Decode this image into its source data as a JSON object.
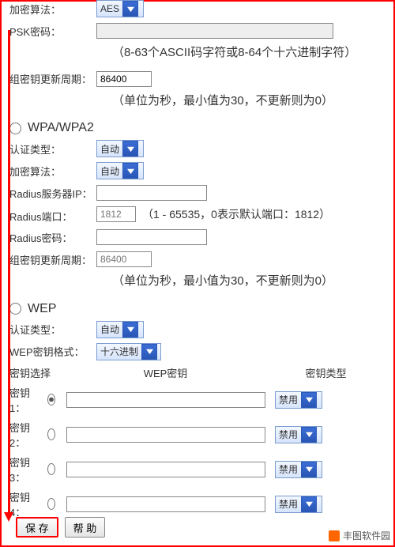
{
  "top": {
    "encrypt_label": "加密算法：",
    "encrypt_val": "AES",
    "psk_label": "PSK密码：",
    "psk_hint": "（8-63个ASCII码字符或8-64个十六进制字符）",
    "group_label": "组密钥更新周期：",
    "group_val": "86400",
    "period_hint": "（单位为秒，最小值为30，不更新则为0）"
  },
  "wpa": {
    "title": "WPA/WPA2",
    "auth_label": "认证类型：",
    "auth_val": "自动",
    "enc_label": "加密算法：",
    "enc_val": "自动",
    "srvip_label": "Radius服务器IP：",
    "port_label": "Radius端口：",
    "port_ph": "1812",
    "port_hint": "（1 - 65535，0表示默认端口：1812）",
    "pw_label": "Radius密码：",
    "group_label": "组密钥更新周期：",
    "group_ph": "86400",
    "period_hint": "（单位为秒，最小值为30，不更新则为0）"
  },
  "wep": {
    "title": "WEP",
    "auth_label": "认证类型：",
    "auth_val": "自动",
    "fmt_label": "WEP密钥格式：",
    "fmt_val": "十六进制",
    "sel_label": "密钥选择",
    "col_key": "WEP密钥",
    "col_type": "密钥类型",
    "rows": [
      {
        "label": "密钥 1：",
        "type": "禁用",
        "sel": "on"
      },
      {
        "label": "密钥 2：",
        "type": "禁用",
        "sel": "off"
      },
      {
        "label": "密钥 3：",
        "type": "禁用",
        "sel": "off"
      },
      {
        "label": "密钥 4：",
        "type": "禁用",
        "sel": "off"
      }
    ]
  },
  "footer": {
    "save": "保 存",
    "help": "帮 助"
  },
  "brand": "丰图软件园"
}
